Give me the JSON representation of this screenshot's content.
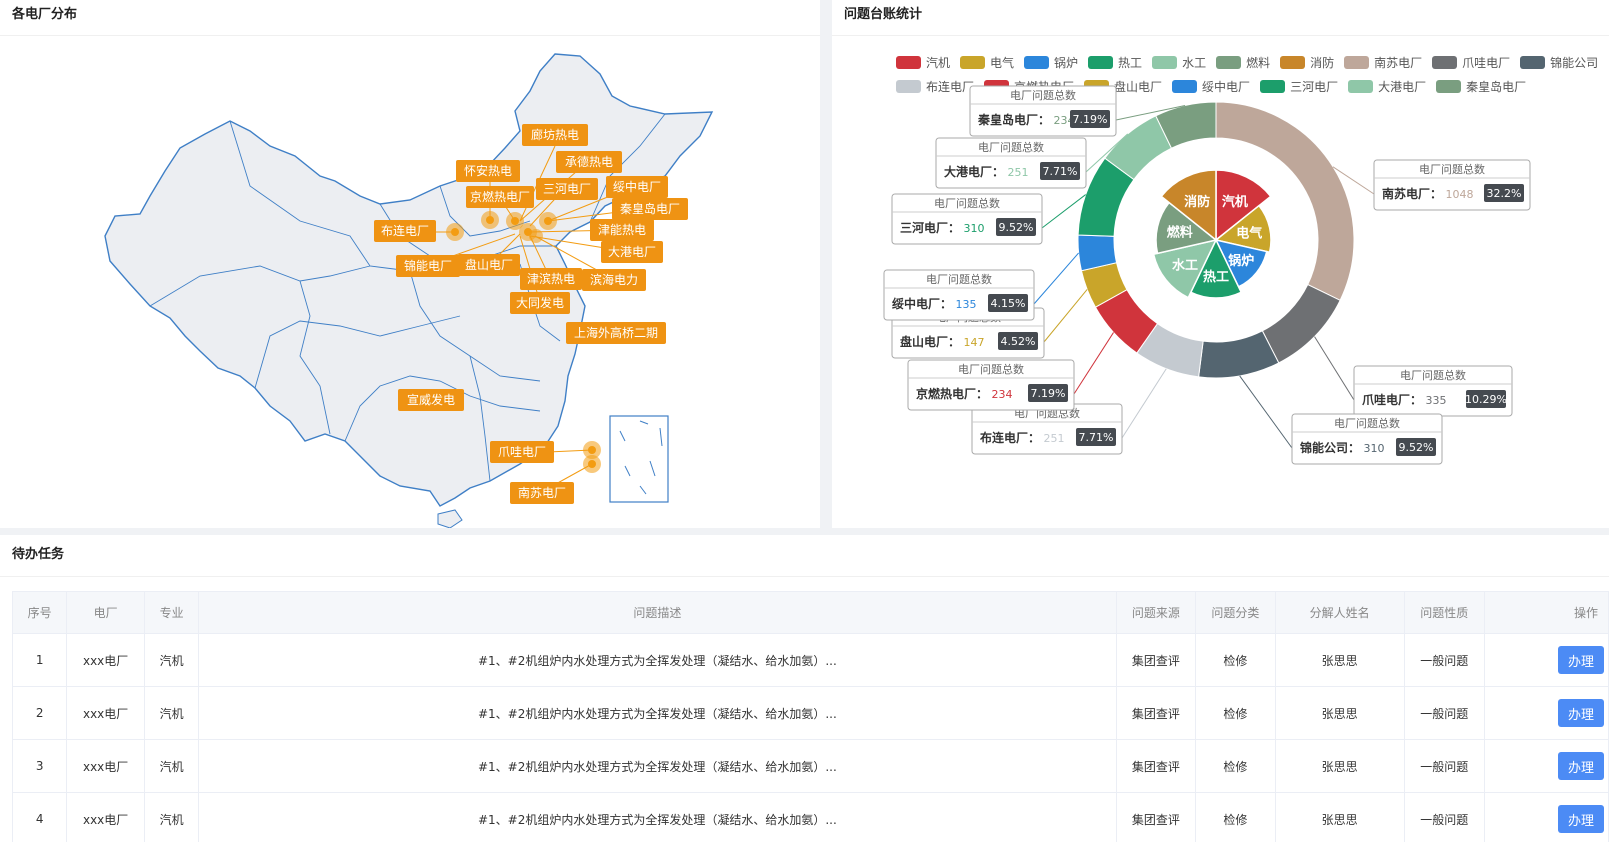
{
  "map": {
    "title": "各电厂分布",
    "labels": [
      "廊坊热电",
      "怀安热电",
      "承德热电",
      "京燃热电厂",
      "三河电厂",
      "绥中电厂",
      "秦皇岛电厂",
      "布连电厂",
      "津能热电",
      "大港电厂",
      "锦能电厂",
      "盘山电厂",
      "津滨热电",
      "滨海电力",
      "大同发电",
      "上海外高桥二期",
      "宣威发电",
      "爪哇电厂",
      "南苏电厂"
    ]
  },
  "chart": {
    "title": "问题台账统计",
    "legend_row1": [
      "汽机",
      "电气",
      "锅炉",
      "热工",
      "水工",
      "燃料",
      "消防",
      "南苏电厂",
      "爪哇电厂",
      "锦能公司"
    ],
    "legend_row2": [
      "布连电厂",
      "京燃热电厂",
      "盘山电厂",
      "绥中电厂",
      "三河电厂",
      "大港电厂",
      "秦皇岛电厂"
    ],
    "tooltip_heading": "电厂问题总数",
    "colors": {
      "汽机": "#d0343c",
      "电气": "#c9a52a",
      "锅炉": "#2c86db",
      "热工": "#1c9e6b",
      "水工": "#8fc7a8",
      "燃料": "#7a9e80",
      "消防": "#c8862a",
      "南苏电厂": "#bea79a",
      "爪哇电厂": "#6e7073",
      "锦能公司": "#546570",
      "布连电厂": "#c4cad0",
      "京燃热电厂": "#d0343c",
      "盘山电厂": "#c9a52a",
      "绥中电厂": "#2c86db",
      "三河电厂": "#1c9e6b",
      "大港电厂": "#8fc7a8",
      "秦皇岛电厂": "#7a9e80"
    }
  },
  "chart_data": {
    "type": "pie",
    "inner": {
      "labels": [
        "汽机",
        "电气",
        "锅炉",
        "热工",
        "水工",
        "燃料",
        "消防"
      ]
    },
    "outer": {
      "labels": [
        "南苏电厂",
        "爪哇电厂",
        "锦能公司",
        "布连电厂",
        "京燃热电厂",
        "盘山电厂",
        "绥中电厂",
        "三河电厂",
        "大港电厂",
        "秦皇岛电厂"
      ],
      "values": [
        1048,
        335,
        310,
        251,
        234,
        147,
        135,
        310,
        251,
        234
      ],
      "percents": [
        "32.2%",
        "10.29%",
        "9.52%",
        "7.71%",
        "7.19%",
        "4.52%",
        "4.15%",
        "9.52%",
        "7.71%",
        "7.19%"
      ]
    }
  },
  "tasks": {
    "title": "待办任务",
    "columns": [
      "序号",
      "电厂",
      "专业",
      "问题描述",
      "问题来源",
      "问题分类",
      "分解人姓名",
      "问题性质",
      "操作"
    ],
    "rows": [
      {
        "no": "1",
        "plant": "xxx电厂",
        "major": "汽机",
        "desc": "#1、#2机组炉内水处理方式为全挥发处理（凝结水、给水加氨）...",
        "source": "集团查评",
        "category": "检修",
        "person": "张思思",
        "nature": "一般问题",
        "action": "办理"
      },
      {
        "no": "2",
        "plant": "xxx电厂",
        "major": "汽机",
        "desc": "#1、#2机组炉内水处理方式为全挥发处理（凝结水、给水加氨）...",
        "source": "集团查评",
        "category": "检修",
        "person": "张思思",
        "nature": "一般问题",
        "action": "办理"
      },
      {
        "no": "3",
        "plant": "xxx电厂",
        "major": "汽机",
        "desc": "#1、#2机组炉内水处理方式为全挥发处理（凝结水、给水加氨）...",
        "source": "集团查评",
        "category": "检修",
        "person": "张思思",
        "nature": "一般问题",
        "action": "办理"
      },
      {
        "no": "4",
        "plant": "xxx电厂",
        "major": "汽机",
        "desc": "#1、#2机组炉内水处理方式为全挥发处理（凝结水、给水加氨）...",
        "source": "集团查评",
        "category": "检修",
        "person": "张思思",
        "nature": "一般问题",
        "action": "办理"
      }
    ]
  }
}
